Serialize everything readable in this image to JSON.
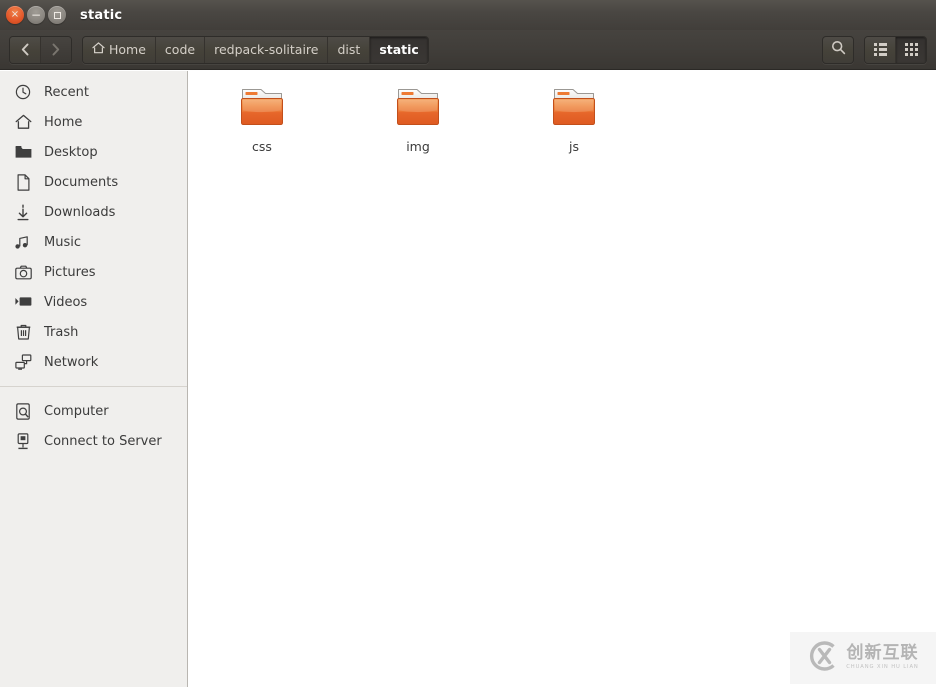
{
  "window": {
    "title": "static",
    "controls": [
      {
        "name": "close",
        "glyph": "×"
      },
      {
        "name": "minimize",
        "glyph": "−"
      },
      {
        "name": "maximize",
        "glyph": "□"
      }
    ]
  },
  "toolbar": {
    "back_label": "‹",
    "forward_label": "›",
    "breadcrumbs": [
      {
        "label": "Home",
        "icon": "home-icon",
        "active": false
      },
      {
        "label": "code",
        "icon": "",
        "active": false
      },
      {
        "label": "redpack-solitaire",
        "icon": "",
        "active": false
      },
      {
        "label": "dist",
        "icon": "",
        "active": false
      },
      {
        "label": "static",
        "icon": "",
        "active": true
      }
    ],
    "search_icon": "search-icon",
    "list_view_icon": "list-view-icon",
    "grid_view_icon": "grid-view-icon",
    "active_view": "grid"
  },
  "sidebar": {
    "items": [
      {
        "label": "Recent",
        "icon": "clock-icon"
      },
      {
        "label": "Home",
        "icon": "home-icon"
      },
      {
        "label": "Desktop",
        "icon": "folder-icon"
      },
      {
        "label": "Documents",
        "icon": "document-icon"
      },
      {
        "label": "Downloads",
        "icon": "download-icon"
      },
      {
        "label": "Music",
        "icon": "music-icon"
      },
      {
        "label": "Pictures",
        "icon": "camera-icon"
      },
      {
        "label": "Videos",
        "icon": "video-icon"
      },
      {
        "label": "Trash",
        "icon": "trash-icon"
      },
      {
        "label": "Network",
        "icon": "network-icon"
      }
    ],
    "items2": [
      {
        "label": "Computer",
        "icon": "computer-icon"
      },
      {
        "label": "Connect to Server",
        "icon": "server-icon"
      }
    ]
  },
  "content": {
    "files": [
      {
        "name": "css",
        "type": "folder",
        "icon": "folder-icon"
      },
      {
        "name": "img",
        "type": "folder",
        "icon": "folder-icon"
      },
      {
        "name": "js",
        "type": "folder",
        "icon": "folder-icon"
      }
    ]
  },
  "watermark": {
    "logo": "cx-logo-icon",
    "chinese": "创新互联",
    "pinyin": "CHUANG XIN HU LIAN"
  },
  "colors": {
    "titlebar": "#46433f",
    "sidebar_bg": "#f0efed",
    "content_bg": "#ffffff",
    "folder_accent": "#e8622a",
    "close_button": "#e2572a"
  }
}
